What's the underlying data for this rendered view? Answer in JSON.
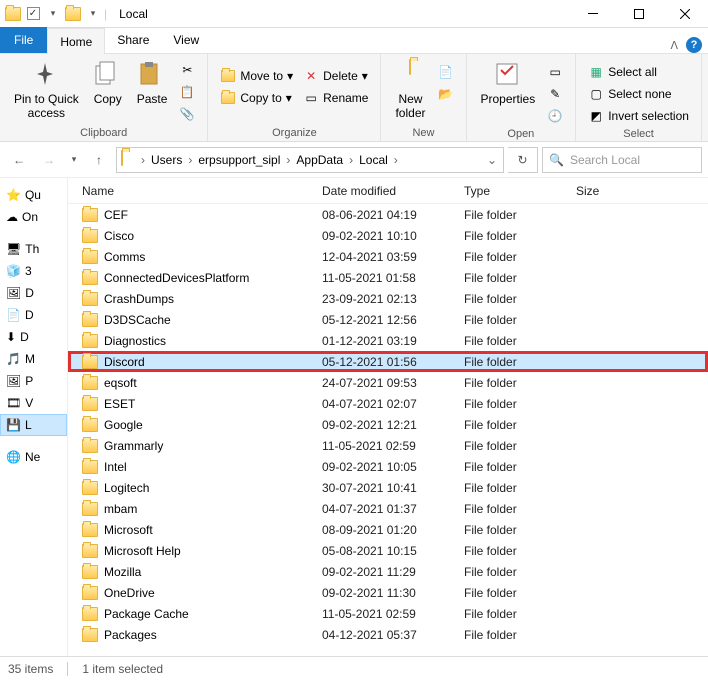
{
  "window": {
    "title": "Local"
  },
  "tabs": {
    "file": "File",
    "home": "Home",
    "share": "Share",
    "view": "View"
  },
  "ribbon": {
    "clipboard": {
      "pin": "Pin to Quick\naccess",
      "copy": "Copy",
      "paste": "Paste",
      "label": "Clipboard"
    },
    "organize": {
      "moveto": "Move to",
      "copyto": "Copy to",
      "delete": "Delete",
      "rename": "Rename",
      "label": "Organize"
    },
    "new": {
      "newfolder": "New\nfolder",
      "label": "New"
    },
    "open": {
      "properties": "Properties",
      "label": "Open"
    },
    "select": {
      "selectall": "Select all",
      "selectnone": "Select none",
      "invert": "Invert selection",
      "label": "Select"
    }
  },
  "breadcrumbs": [
    "Users",
    "erpsupport_sipl",
    "AppData",
    "Local"
  ],
  "search_placeholder": "Search Local",
  "columns": {
    "name": "Name",
    "date": "Date modified",
    "type": "Type",
    "size": "Size"
  },
  "tree": [
    {
      "icon": "star",
      "label": "Qu",
      "sel": false
    },
    {
      "icon": "cloud",
      "label": "On",
      "sel": false
    },
    {
      "icon": "pc",
      "label": "Th",
      "sel": false
    },
    {
      "icon": "obj",
      "label": "3",
      "sel": false
    },
    {
      "icon": "desk",
      "label": "D",
      "sel": false
    },
    {
      "icon": "doc",
      "label": "D",
      "sel": false
    },
    {
      "icon": "down",
      "label": "D",
      "sel": false
    },
    {
      "icon": "music",
      "label": "M",
      "sel": false
    },
    {
      "icon": "pic",
      "label": "P",
      "sel": false
    },
    {
      "icon": "vid",
      "label": "V",
      "sel": false
    },
    {
      "icon": "disk",
      "label": "L",
      "sel": true
    },
    {
      "icon": "net",
      "label": "Ne",
      "sel": false
    }
  ],
  "items": [
    {
      "name": "CEF",
      "date": "08-06-2021 04:19",
      "type": "File folder"
    },
    {
      "name": "Cisco",
      "date": "09-02-2021 10:10",
      "type": "File folder"
    },
    {
      "name": "Comms",
      "date": "12-04-2021 03:59",
      "type": "File folder"
    },
    {
      "name": "ConnectedDevicesPlatform",
      "date": "11-05-2021 01:58",
      "type": "File folder"
    },
    {
      "name": "CrashDumps",
      "date": "23-09-2021 02:13",
      "type": "File folder"
    },
    {
      "name": "D3DSCache",
      "date": "05-12-2021 12:56",
      "type": "File folder"
    },
    {
      "name": "Diagnostics",
      "date": "01-12-2021 03:19",
      "type": "File folder"
    },
    {
      "name": "Discord",
      "date": "05-12-2021 01:56",
      "type": "File folder",
      "hl": true
    },
    {
      "name": "eqsoft",
      "date": "24-07-2021 09:53",
      "type": "File folder"
    },
    {
      "name": "ESET",
      "date": "04-07-2021 02:07",
      "type": "File folder"
    },
    {
      "name": "Google",
      "date": "09-02-2021 12:21",
      "type": "File folder"
    },
    {
      "name": "Grammarly",
      "date": "11-05-2021 02:59",
      "type": "File folder"
    },
    {
      "name": "Intel",
      "date": "09-02-2021 10:05",
      "type": "File folder"
    },
    {
      "name": "Logitech",
      "date": "30-07-2021 10:41",
      "type": "File folder"
    },
    {
      "name": "mbam",
      "date": "04-07-2021 01:37",
      "type": "File folder"
    },
    {
      "name": "Microsoft",
      "date": "08-09-2021 01:20",
      "type": "File folder"
    },
    {
      "name": "Microsoft Help",
      "date": "05-08-2021 10:15",
      "type": "File folder"
    },
    {
      "name": "Mozilla",
      "date": "09-02-2021 11:29",
      "type": "File folder"
    },
    {
      "name": "OneDrive",
      "date": "09-02-2021 11:30",
      "type": "File folder"
    },
    {
      "name": "Package Cache",
      "date": "11-05-2021 02:59",
      "type": "File folder"
    },
    {
      "name": "Packages",
      "date": "04-12-2021 05:37",
      "type": "File folder"
    }
  ],
  "status": {
    "count": "35 items",
    "selected": "1 item selected"
  }
}
